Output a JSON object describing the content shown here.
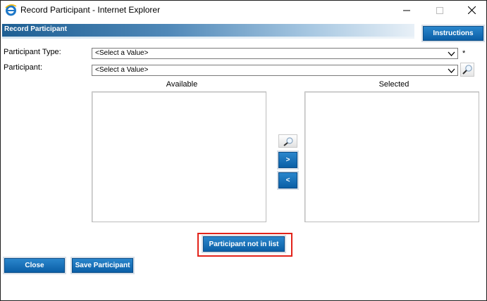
{
  "window": {
    "title": "Record Participant - Internet Explorer",
    "controls": {
      "minimize": "minimize",
      "maximize": "maximize",
      "close": "close"
    }
  },
  "header": {
    "title": "Record Participant",
    "instructions_label": "Instructions"
  },
  "form": {
    "participant_type": {
      "label": "Participant Type:",
      "value": "<Select a Value>",
      "required_marker": "*"
    },
    "participant": {
      "label": "Participant:",
      "value": "<Select a Value>"
    }
  },
  "lists": {
    "available_heading": "Available",
    "selected_heading": "Selected",
    "add_label": ">",
    "remove_label": "<"
  },
  "actions": {
    "not_in_list_label": "Participant not in list",
    "close_label": "Close",
    "save_label": "Save Participant"
  },
  "colors": {
    "button_blue": "#0b6cb8",
    "highlight_red": "#e2231a",
    "header_band": "#1e5f93"
  },
  "icons": [
    "ie-icon",
    "minimize-icon",
    "maximize-icon",
    "close-icon",
    "chevron-down-icon",
    "search-icon"
  ]
}
